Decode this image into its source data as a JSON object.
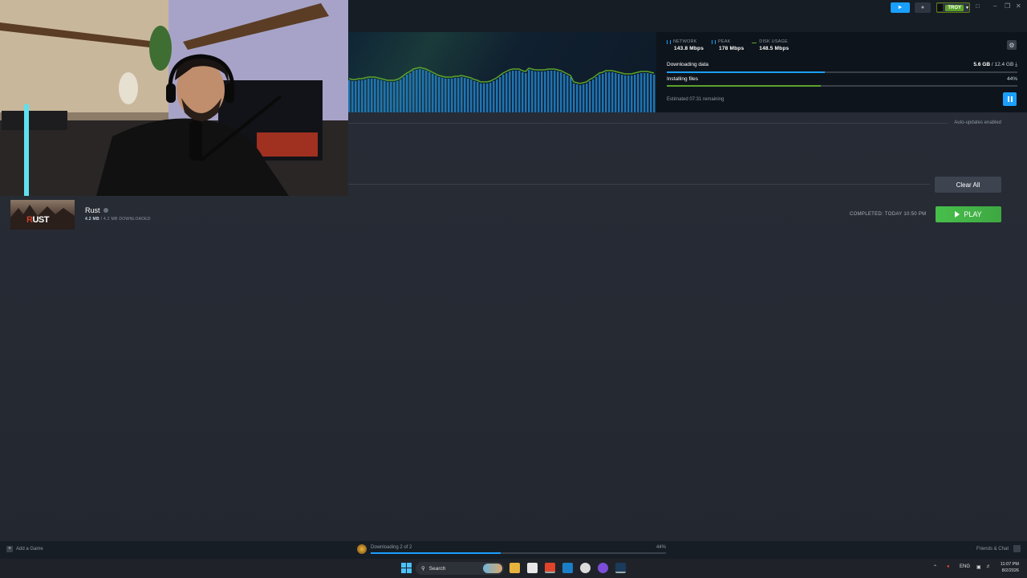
{
  "titlebar": {
    "username": "TROY",
    "window_controls": [
      "minimize",
      "maximize",
      "close"
    ]
  },
  "download": {
    "stats": [
      {
        "label": "NETWORK",
        "value": "143.8 Mbps",
        "color": "#1a9fff"
      },
      {
        "label": "PEAK",
        "value": "178 Mbps",
        "color": "#1a9fff"
      },
      {
        "label": "DISK USAGE",
        "value": "148.5 Mbps",
        "color": "#5ba32b"
      }
    ],
    "downloading_label": "Downloading data",
    "downloaded": "5.6 GB",
    "separator": "/",
    "total": "12.4 GB",
    "downloading_fraction": 0.45,
    "installing_label": "Installing files",
    "installing_percent_text": "44%",
    "installing_fraction": 0.44,
    "estimated": "Estimated 07:31 remaining",
    "auto_updates": "Auto-updates enabled"
  },
  "completed_section": {
    "clear_all": "Clear All"
  },
  "game": {
    "title": "Rust",
    "size": "4.2 MB",
    "downloaded_text": "/ 4.2 MB DOWNLOADED",
    "thumb_logo_prefix": "R",
    "thumb_logo_rest": "UST",
    "completed": "COMPLETED: TODAY 10:50 PM",
    "play_label": "PLAY"
  },
  "bottombar": {
    "add_game": "Add a Game",
    "download_status": "Downloading 2 of 2",
    "download_percent": "44%",
    "download_fraction": 0.44,
    "friends": "Friends & Chat"
  },
  "taskbar": {
    "search_placeholder": "Search",
    "language": "ENG",
    "time": "11:07 PM",
    "date": "8/2/2026"
  },
  "colors": {
    "accent_blue": "#1a9fff",
    "play_green": "#47bf4b",
    "disk_green": "#5ba32b"
  }
}
